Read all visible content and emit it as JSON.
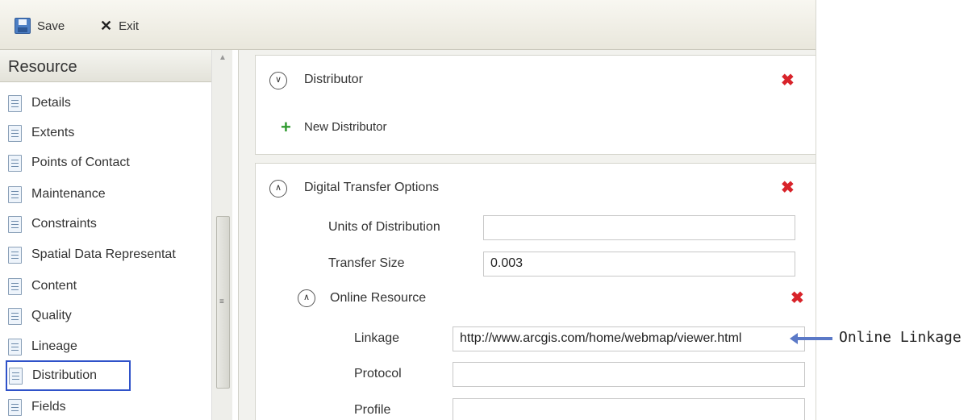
{
  "toolbar": {
    "save_label": "Save",
    "exit_label": "Exit"
  },
  "nav": {
    "header": "Resource",
    "items": [
      {
        "label": "Details"
      },
      {
        "label": "Extents"
      },
      {
        "label": "Points of Contact"
      },
      {
        "label": "Maintenance"
      },
      {
        "label": "Constraints"
      },
      {
        "label": "Spatial Data Representat"
      },
      {
        "label": "Content"
      },
      {
        "label": "Quality"
      },
      {
        "label": "Lineage"
      },
      {
        "label": "Distribution",
        "selected": true
      },
      {
        "label": "Fields"
      }
    ]
  },
  "distributor": {
    "title": "Distributor",
    "new_label": "New Distributor"
  },
  "digital_transfer": {
    "title": "Digital Transfer Options",
    "units_label": "Units of Distribution",
    "units_value": "",
    "size_label": "Transfer Size",
    "size_value": "0.003",
    "online_resource": {
      "title": "Online Resource",
      "linkage_label": "Linkage",
      "linkage_value": "http://www.arcgis.com/home/webmap/viewer.html",
      "protocol_label": "Protocol",
      "protocol_value": "",
      "profile_label": "Profile",
      "profile_value": ""
    }
  },
  "annotation": {
    "label": "Online Linkage"
  },
  "colors": {
    "selection_border": "#2f52c9",
    "delete_red": "#d8232a",
    "add_green": "#2f9a2f",
    "annotation_arrow": "#5b79c7"
  }
}
